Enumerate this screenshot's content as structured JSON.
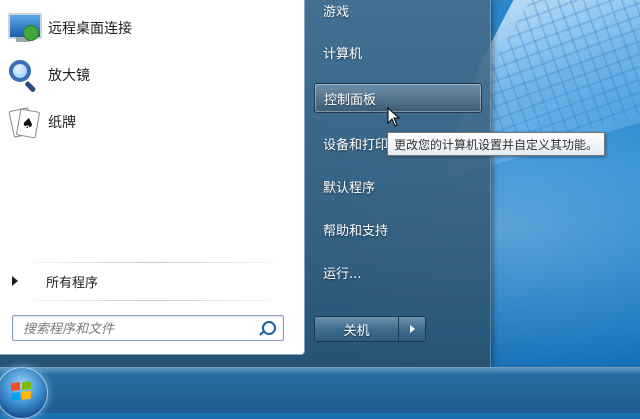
{
  "left_pane": {
    "programs": [
      {
        "label": "远程桌面连接",
        "icon": "remote-desktop-icon"
      },
      {
        "label": "放大镜",
        "icon": "magnifier-icon"
      },
      {
        "label": "纸牌",
        "icon": "solitaire-icon"
      }
    ],
    "all_programs_label": "所有程序",
    "search_placeholder": "搜索程序和文件"
  },
  "right_pane": {
    "items": [
      {
        "label": "游戏"
      },
      {
        "label": "计算机"
      },
      {
        "label": "控制面板",
        "highlighted": true
      },
      {
        "label": "设备和打印"
      },
      {
        "label": "默认程序"
      },
      {
        "label": "帮助和支持"
      },
      {
        "label": "运行..."
      }
    ],
    "shutdown_label": "关机"
  },
  "tooltip": {
    "text": "更改您的计算机设置并自定义其功能。"
  },
  "colors": {
    "desktop": "#2a8bd3",
    "menu_frame": "#3f6c8f",
    "highlight": "#5a7f9f"
  }
}
